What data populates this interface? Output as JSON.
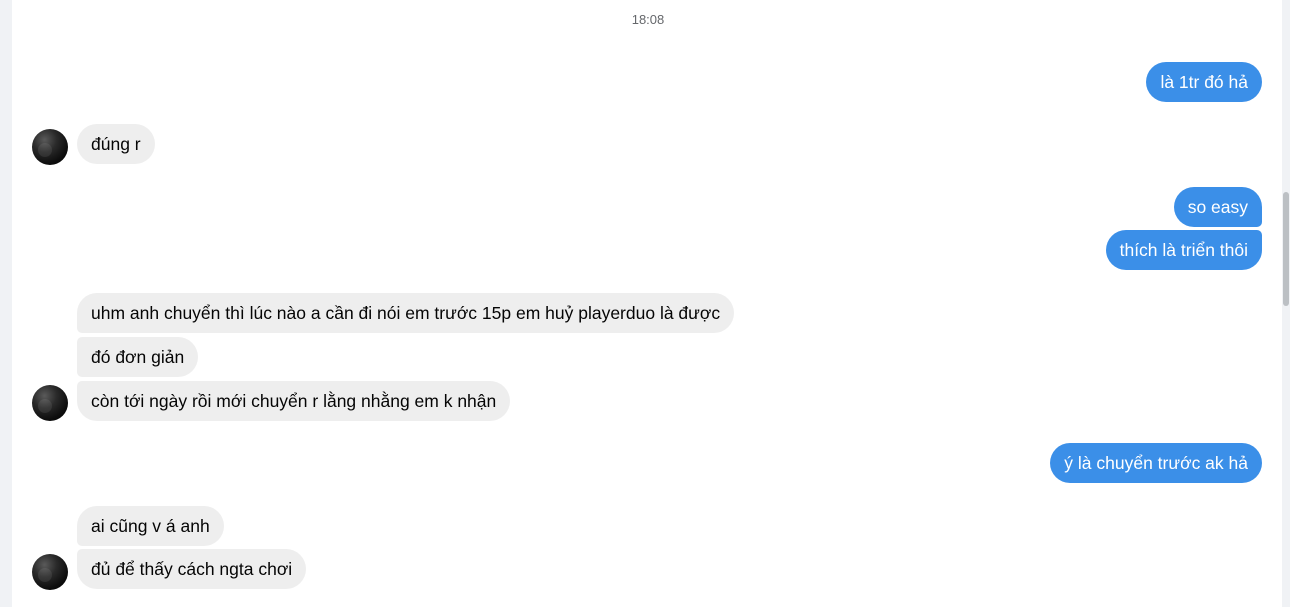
{
  "chat": {
    "timestamp": "18:08",
    "messages": [
      {
        "id": "m1",
        "direction": "outgoing",
        "text": "là 1tr đó hả"
      },
      {
        "id": "m2",
        "direction": "incoming",
        "text": "đúng r"
      },
      {
        "id": "m3",
        "direction": "outgoing",
        "text": "so easy"
      },
      {
        "id": "m4",
        "direction": "outgoing",
        "text": "thích là triển thôi"
      },
      {
        "id": "m5",
        "direction": "incoming",
        "text": "uhm anh chuyển thì lúc nào a cần đi nói em trước 15p em huỷ playerduo là được"
      },
      {
        "id": "m6",
        "direction": "incoming",
        "text": "đó đơn giản"
      },
      {
        "id": "m7",
        "direction": "incoming",
        "text": "còn tới ngày rồi mới chuyển r lằng nhằng em k nhận"
      },
      {
        "id": "m8",
        "direction": "outgoing",
        "text": "ý là chuyển trước ak hả"
      },
      {
        "id": "m9",
        "direction": "incoming",
        "text": "ai cũng v á anh"
      },
      {
        "id": "m10",
        "direction": "incoming",
        "text": "đủ để thấy cách ngta chơi"
      }
    ]
  },
  "colors": {
    "outgoing_bubble": "#3b8fe8",
    "incoming_bubble": "#eeeeee",
    "background": "#ffffff"
  }
}
